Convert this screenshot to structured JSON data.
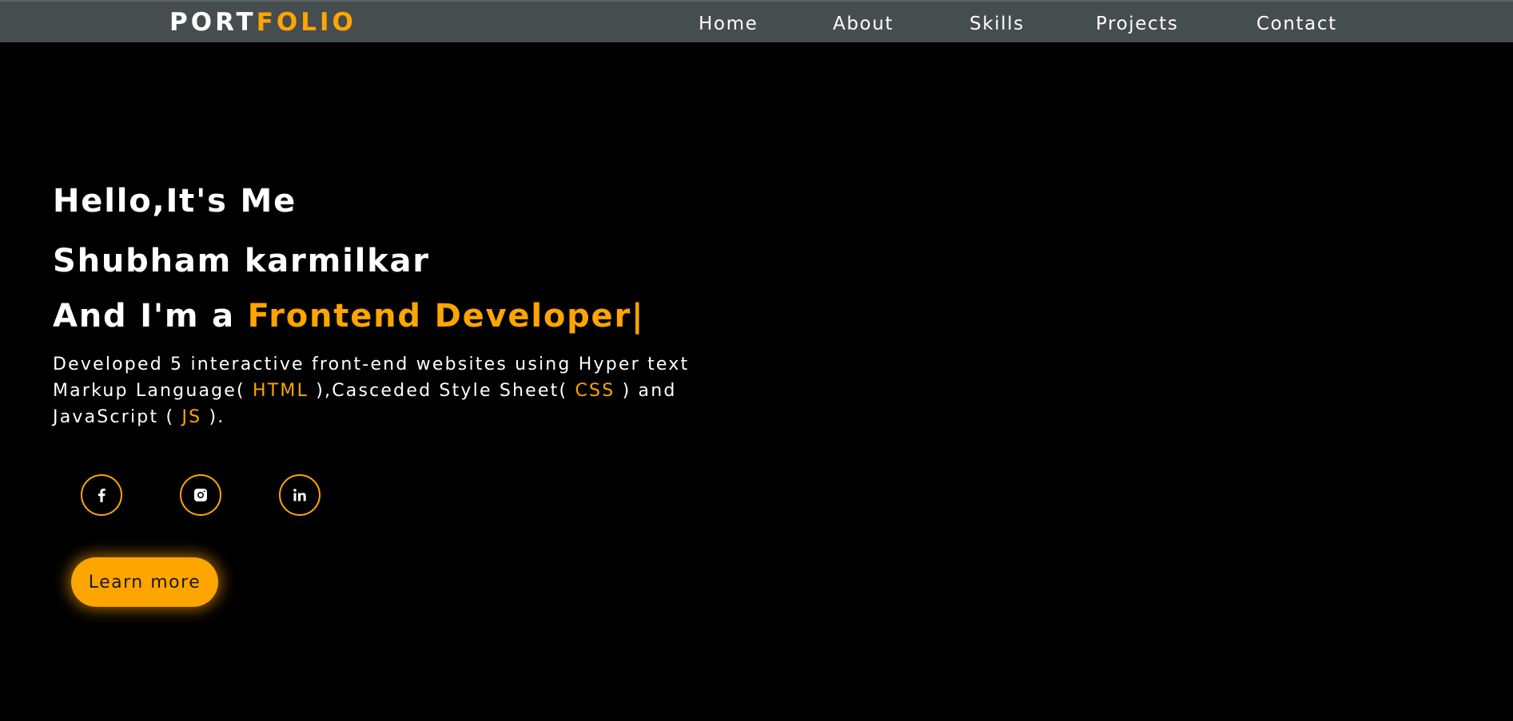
{
  "nav": {
    "logo_part1": "PORT",
    "logo_part2": "FOLIO",
    "links": [
      "Home",
      "About",
      "Skills",
      "Projects",
      "Contact"
    ]
  },
  "hero": {
    "greeting": "Hello,It's Me",
    "name": "Shubham karmilkar",
    "role_prefix": "And I'm a ",
    "role": "Frontend Developer|",
    "description": {
      "line1": "Developed 5 interactive front-end websites using Hyper text",
      "line2_a": "Markup Language( ",
      "line2_html": "HTML",
      "line2_b": " ),Casceded Style Sheet( ",
      "line2_css": "CSS",
      "line2_c": " ) and",
      "line3_a": "JavaScript ( ",
      "line3_js": "JS",
      "line3_b": " )."
    },
    "socials": [
      "facebook-icon",
      "instagram-icon",
      "linkedin-icon"
    ],
    "cta_label": "Learn more"
  },
  "colors": {
    "background": "#000000",
    "navbar": "#454d4f",
    "accent": "#ffa500",
    "text": "#ffffff"
  }
}
